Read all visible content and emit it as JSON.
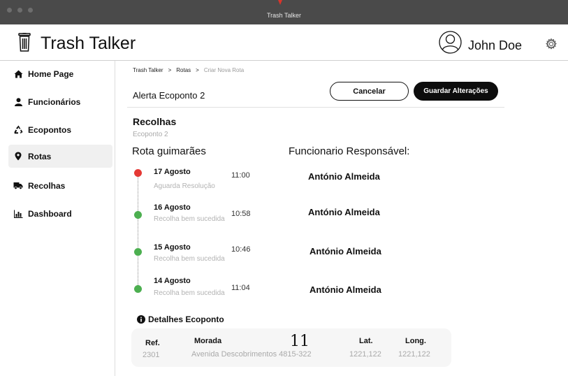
{
  "window": {
    "title": "Trash Talker"
  },
  "header": {
    "app_name": "Trash Talker",
    "user_name": "John Doe"
  },
  "sidebar": {
    "items": [
      {
        "label": "Home Page",
        "icon": "home-icon"
      },
      {
        "label": "Funcionários",
        "icon": "person-icon"
      },
      {
        "label": "Ecopontos",
        "icon": "recycle-icon"
      },
      {
        "label": "Rotas",
        "icon": "map-pin-icon",
        "active": true
      },
      {
        "label": "Recolhas",
        "icon": "truck-icon"
      },
      {
        "label": "Dashboard",
        "icon": "bar-chart-icon"
      }
    ]
  },
  "breadcrumb": {
    "items": [
      "Trash Talker",
      "Rotas",
      "Criar Nova Rota"
    ],
    "separator": ">"
  },
  "alert": {
    "title": "Alerta Ecoponto 2"
  },
  "actions": {
    "cancel_label": "Cancelar",
    "save_label": "Guardar Alterações"
  },
  "recolhas": {
    "title": "Recolhas",
    "subtitle": "Ecoponto 2",
    "route_title": "Rota guimarães",
    "responsible_title": "Funcionario Responsável:",
    "entries": [
      {
        "date": "17 Agosto",
        "status": "Aguarda Resolução",
        "time": "11:00",
        "person": "António Almeida",
        "color": "#e53935"
      },
      {
        "date": "16 Agosto",
        "status": "Recolha bem sucedida",
        "time": "10:58",
        "person": "António Almeida",
        "color": "#4caf50"
      },
      {
        "date": "15 Agosto",
        "status": "Recolha bem sucedida",
        "time": "10:46",
        "person": "António Almeida",
        "color": "#4caf50"
      },
      {
        "date": "14 Agosto",
        "status": "Recolha bem sucedida",
        "time": "11:04",
        "person": "António Almeida",
        "color": "#4caf50"
      }
    ]
  },
  "details": {
    "title": "Detalhes Ecoponto",
    "ref_label": "Ref.",
    "ref_value": "2301",
    "morada_label": "Morada",
    "morada_value": "Avenida Descobrimentos 4815-322",
    "number": "11",
    "lat_label": "Lat.",
    "lat_value": "1221,122",
    "long_label": "Long.",
    "long_value": "1221,122"
  }
}
